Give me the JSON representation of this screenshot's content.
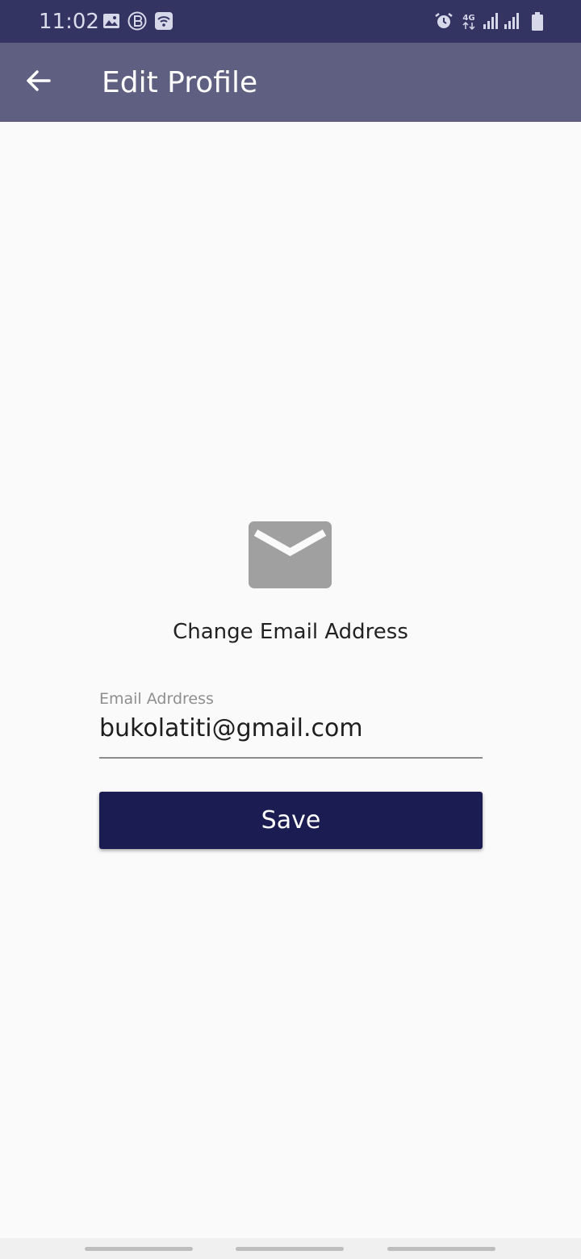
{
  "status_bar": {
    "time": "11:02",
    "network_label": "4G",
    "left_icons": [
      "image-icon",
      "b-circle-icon",
      "wifi-icon"
    ],
    "right_icons": [
      "alarm-icon",
      "network-4g-icon",
      "signal-icon",
      "signal-icon",
      "battery-icon"
    ]
  },
  "app_bar": {
    "title": "Edit Profile",
    "back_icon": "arrow-left-icon"
  },
  "main": {
    "icon": "mail-icon",
    "heading": "Change Email Address",
    "email_field": {
      "label": "Email Adrdress",
      "value": "bukolatiti@gmail.com"
    },
    "save_label": "Save"
  },
  "colors": {
    "status_bar": "#343463",
    "app_bar": "#5f5f81",
    "background": "#fafafa",
    "primary_button": "#1b1c52",
    "icon_grey": "#a0a0a0"
  }
}
